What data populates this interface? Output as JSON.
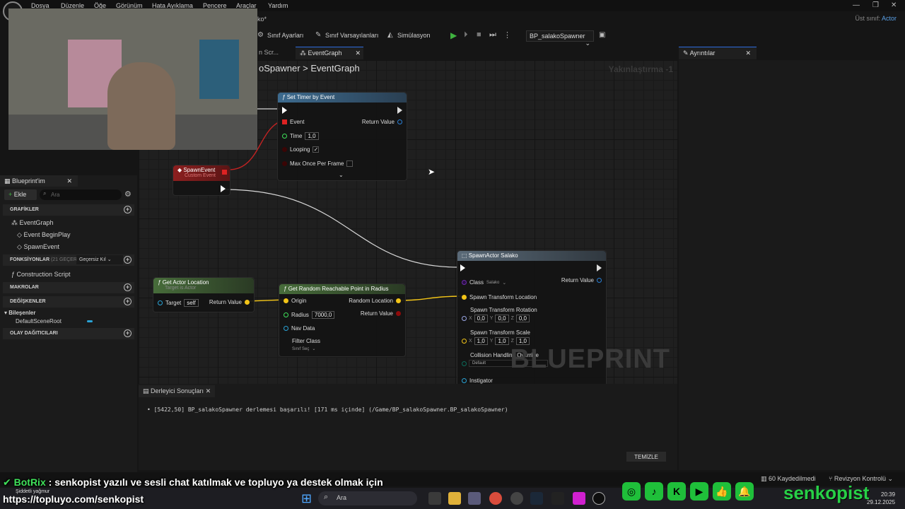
{
  "menu": {
    "items": [
      "Dosya",
      "Düzenle",
      "Öğe",
      "Görünüm",
      "Hata Ayıklama",
      "Pencere",
      "Araçlar",
      "Yardım"
    ],
    "window_title_fragment": "ko*",
    "parent_class_label": "Üst sınıf:",
    "parent_class_value": "Actor"
  },
  "toolbar": {
    "class_settings": "Sınıf Ayarları",
    "class_defaults": "Sınıf Varsayılanları",
    "simulation": "Simülasyon",
    "blueprint_select": "BP_salakoSpawner"
  },
  "tabs": {
    "construction_partial": "n Scr...",
    "event_graph": "EventGraph",
    "details": "Ayrıntılar"
  },
  "graph": {
    "breadcrumb_parent": "oSpawner",
    "breadcrumb_sep": ">",
    "breadcrumb_current": "EventGraph",
    "zoom": "Yakınlaştırma -1",
    "watermark": "BLUEPRINT",
    "nodes": {
      "set_timer": {
        "title": "Set Timer by Event",
        "event": "Event",
        "return_value": "Return Value",
        "time_label": "Time",
        "time_value": "1,0",
        "looping_label": "Looping",
        "looping_check": "✓",
        "max_once_label": "Max Once Per Frame"
      },
      "spawn_event": {
        "title": "SpawnEvent",
        "subtitle": "Custom Event"
      },
      "get_actor_location": {
        "title": "Get Actor Location",
        "subtitle": "Target is Actor",
        "target_label": "Target",
        "target_value": "self",
        "return_value": "Return Value"
      },
      "random_point": {
        "title": "Get Random Reachable Point in Radius",
        "origin": "Origin",
        "random_location": "Random Location",
        "radius_label": "Radius",
        "radius_value": "7000,0",
        "return_value": "Return Value",
        "nav_data": "Nav Data",
        "filter_class": "Filter Class",
        "filter_select": "Sınıf Seç"
      },
      "spawn_actor": {
        "title": "SpawnActor Salako",
        "class_label": "Class",
        "class_value": "Salako",
        "return_value": "Return Value",
        "spawn_loc": "Spawn Transform Location",
        "spawn_rot": "Spawn Transform Rotation",
        "rot_x": "0,0",
        "rot_y": "0,0",
        "rot_z": "0,0",
        "spawn_scale": "Spawn Transform Scale",
        "scale_x": "1,0",
        "scale_y": "1,0",
        "scale_z": "1,0",
        "collision": "Collision Handling Override",
        "collision_value": "Default",
        "instigator": "Instigator",
        "axis_x": "X",
        "axis_y": "Y",
        "axis_z": "Z"
      }
    }
  },
  "blueprint_panel": {
    "title": "Blueprint'im",
    "add_button": "Ekle",
    "search_placeholder": "Ara",
    "sections": {
      "graphs": "GRAFİKLER",
      "functions": "FONKSİYONLAR",
      "functions_count": "(21 GEÇERSİ",
      "override": "Geçersiz Kıl",
      "macros": "MAKROLAR",
      "variables": "DEĞİŞKENLER",
      "dispatchers": "OLAY DAĞITICILARI"
    },
    "items": {
      "event_graph": "EventGraph",
      "begin_play": "Event BeginPlay",
      "spawn_event": "SpawnEvent",
      "construction": "Construction Script",
      "components": "Bileşenler",
      "root": "DefaultSceneRoot"
    }
  },
  "compiler": {
    "tab": "Derleyici Sonuçları",
    "message": "[5422,50] BP_salakoSpawner derlemesi başarılı! [171 ms içinde] (/Game/BP_salakoSpawner.BP_salakoSpawner)",
    "clear": "TEMİZLE"
  },
  "status": {
    "saved": "60 Kaydedilmedi",
    "revision": "Revizyon Kontrolü"
  },
  "overlay": {
    "chat_user": "BotRix",
    "chat_text": ": senkopist yazılı ve sesli chat katılmak ve topluyo ya destek olmak için",
    "url": "https://topluyo.com/senkopist",
    "brand": "senkopist",
    "weather": "Şiddetli yağmur"
  },
  "taskbar": {
    "search": "Ara",
    "time": "20:39",
    "date": "29.12.2025"
  },
  "colors": {
    "accent_blue": "#2d6cdf",
    "exec_white": "#ffffff",
    "vector_yellow": "#f2c418",
    "object_blue": "#2aa3d6",
    "bool_red": "#8e0b0b",
    "float_green": "#3fe15a",
    "brand_green": "#27d046"
  }
}
